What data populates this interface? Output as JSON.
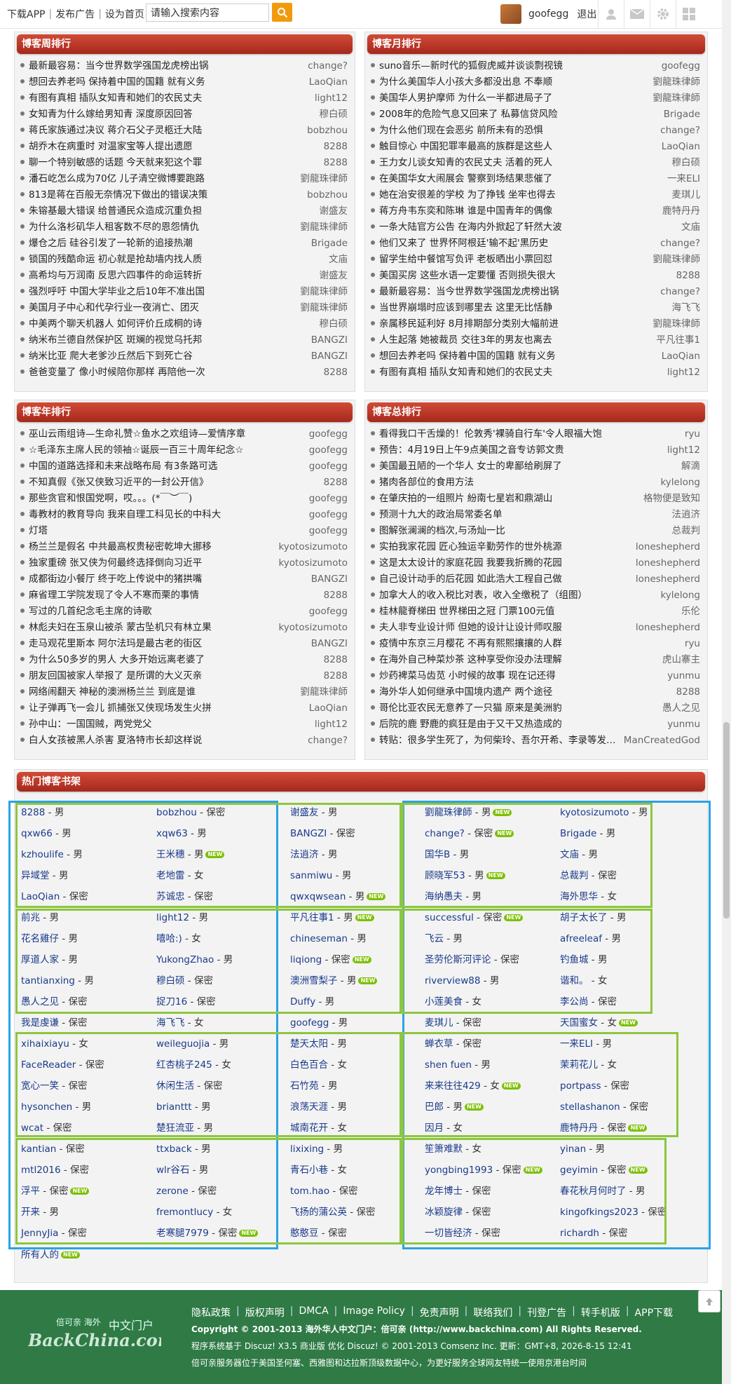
{
  "topbar": {
    "nav": [
      "下载APP",
      "发布广告",
      "设为首页"
    ],
    "search_placeholder": "请输入搜索内容",
    "username": "goofegg",
    "logout": "退出"
  },
  "panels": {
    "weekly": {
      "title": "博客周排行",
      "items": [
        {
          "t": "最新最容易：当今世界数学强国龙虎榜出锅",
          "a": "change?"
        },
        {
          "t": "想回去养老吗 保持着中国的国籍 就有义务",
          "a": "LaoQian"
        },
        {
          "t": "有图有真相 插队女知青和她们的农民丈夫",
          "a": "light12"
        },
        {
          "t": "女知青为什么嫁给男知青 深度原因回答",
          "a": "穆白硕"
        },
        {
          "t": "蒋氏家族通过决议 蒋介石父子灵柩迁大陆",
          "a": "bobzhou"
        },
        {
          "t": "胡乔木在病重时 对温家宝等人提出遗愿",
          "a": "8288"
        },
        {
          "t": "聊一个特别敏感的话题 今天就来犯这个罪",
          "a": "8288"
        },
        {
          "t": "潘石屹怎么成为70亿 儿子清空微博要跑路",
          "a": "劉龍珠律師"
        },
        {
          "t": "813是蒋在百般无奈情况下做出的错误决策",
          "a": "bobzhou"
        },
        {
          "t": "朱镕基最大错误 给普通民众造成沉重负担",
          "a": "谢盛友"
        },
        {
          "t": "为什么洛杉矶华人租客数不尽的恩怨情仇",
          "a": "劉龍珠律師"
        },
        {
          "t": "爆仓之后 硅谷引发了一轮新的追接热潮",
          "a": "Brigade"
        },
        {
          "t": "锁国的残酷命运 初心就是抢劫墙内找人质",
          "a": "文庙"
        },
        {
          "t": "高希均与万润南 反思六四事件的命运转折",
          "a": "谢盛友"
        },
        {
          "t": "强烈呼吁 中国大学毕业之后10年不准出国",
          "a": "劉龍珠律師"
        },
        {
          "t": "美国月子中心和代孕行业一夜消亡、团灭",
          "a": "劉龍珠律師"
        },
        {
          "t": "中美两个聊天机器人 如何评价丘成桐的诗",
          "a": "穆白硕"
        },
        {
          "t": "纳米布兰德自然保护区 斑斓的视觉乌托邦",
          "a": "BANGZI"
        },
        {
          "t": "纳米比亚 爬大老爹沙丘然后下到死亡谷",
          "a": "BANGZI"
        },
        {
          "t": "爸爸变量了 像小时候陪你那样 再陪他一次",
          "a": "8288"
        }
      ]
    },
    "monthly": {
      "title": "博客月排行",
      "items": [
        {
          "t": "suno音乐—新时代的狐假虎威并谈谈剽视镜",
          "a": "goofegg"
        },
        {
          "t": "为什么美国华人小孩大多都没出息 不奉顺",
          "a": "劉龍珠律師"
        },
        {
          "t": "美国华人男护摩师 为什么一半都进局子了",
          "a": "劉龍珠律師"
        },
        {
          "t": "2008年的危险气息又回来了 私募信贷风险",
          "a": "Brigade"
        },
        {
          "t": "为什么他们现在会恶劣 前所未有的恐惧",
          "a": "change?"
        },
        {
          "t": "触目惊心 中国犯罪率最高的族群是这些人",
          "a": "LaoQian"
        },
        {
          "t": "王力女儿谈女知青的农民丈夫 活着的死人",
          "a": "穆白硕"
        },
        {
          "t": "在美国华女大闹展会 警察到场结果悲催了",
          "a": "一来ELI"
        },
        {
          "t": "她在治安很差的学校 为了挣钱 坐牢也得去",
          "a": "麦琪儿"
        },
        {
          "t": "蒋方舟韦东奕和陈琳 谁是中国青年的偶像",
          "a": "鹿特丹丹"
        },
        {
          "t": "一条大陆官方公告 在海内外掀起了轩然大波",
          "a": "文庙"
        },
        {
          "t": "他们又来了 世界怀阿根廷'输不起'黑历史",
          "a": "change?"
        },
        {
          "t": "留学生给中餐馆写负评 老板晒出小票回怼",
          "a": "劉龍珠律師"
        },
        {
          "t": "美国买房 这些水语一定要懂 否则损失很大",
          "a": "8288"
        },
        {
          "t": "最新最容易：当今世界数学强国龙虎榜出锅",
          "a": "change?"
        },
        {
          "t": "当世界崩塌时应该到哪里去 这里无比恬静",
          "a": "海飞飞"
        },
        {
          "t": "亲属移民延利好 8月排期部分类别大幅前进",
          "a": "劉龍珠律師"
        },
        {
          "t": "人生起落 她被裁员 交往3年的男友也离去",
          "a": "平凡往事1"
        },
        {
          "t": "想回去养老吗 保持着中国的国籍 就有义务",
          "a": "LaoQian"
        },
        {
          "t": "有图有真相 插队女知青和她们的农民丈夫",
          "a": "light12"
        }
      ]
    },
    "yearly": {
      "title": "博客年排行",
      "items": [
        {
          "t": "巫山云雨组诗—生命礼赞☆鱼水之欢组诗—爱情序章",
          "a": "goofegg"
        },
        {
          "t": "☆毛泽东主席人民的领袖☆诞辰一百三十周年纪念☆",
          "a": "goofegg"
        },
        {
          "t": "中国的道路选择和未来战略布局 有3条路可选",
          "a": "goofegg"
        },
        {
          "t": "不知真假《张又侠致习近平的一封公开信》",
          "a": "8288"
        },
        {
          "t": "那些贪官和恨国党啊，哎。。。(*￣︶￣)",
          "a": "goofegg"
        },
        {
          "t": "毒教材的教育导向 我来自理工科见长的中科大",
          "a": "goofegg"
        },
        {
          "t": "灯塔",
          "a": "goofegg"
        },
        {
          "t": "杨兰兰是假名 中共最高权贵秘密乾坤大挪移",
          "a": "kyotosizumoto"
        },
        {
          "t": "独家重磅 张又侠为何最终选择倒向习近平",
          "a": "kyotosizumoto"
        },
        {
          "t": "成都街边小餐厅 终于吃上传说中的猪拱嘴",
          "a": "BANGZI"
        },
        {
          "t": "麻省理工学院发现了令人不寒而栗的事情",
          "a": "8288"
        },
        {
          "t": "写过的几首纪念毛主席的诗歌",
          "a": "goofegg"
        },
        {
          "t": "林彪夫妇在玉泉山被杀 蒙古坠机只有林立果",
          "a": "kyotosizumoto"
        },
        {
          "t": "走马观花里斯本 阿尔法玛是最古老的街区",
          "a": "BANGZI"
        },
        {
          "t": "为什么50多岁的男人 大多开始远离老婆了",
          "a": "8288"
        },
        {
          "t": "朋友回国被家人举报了 是所谓的大义灭亲",
          "a": "8288"
        },
        {
          "t": "网络闹翻天 神秘的澳洲杨兰兰 到底是谁",
          "a": "劉龍珠律師"
        },
        {
          "t": "让子弹再飞一会儿 抓捕张又侠现场发生火拼",
          "a": "LaoQian"
        },
        {
          "t": "孙中山：一国国贼，两党党父",
          "a": "light12"
        },
        {
          "t": "白人女孩被黑人杀害 夏洛特市长却这样说",
          "a": "change?"
        }
      ]
    },
    "total": {
      "title": "博客总排行",
      "items": [
        {
          "t": "看得我口干舌燥的！伦敦秀'裸骑自行车'令人眼福大饱",
          "a": "ryu"
        },
        {
          "t": "预告：4月19日上午9点美国之音专访郭文贵",
          "a": "light12"
        },
        {
          "t": "美国最丑陋的一个华人 女士的卑鄙给刷屏了",
          "a": "解滴"
        },
        {
          "t": "猪肉各部位的食用方法",
          "a": "kylelong"
        },
        {
          "t": "在肇庆拍的一组照片 紛南七星岩和鼎湖山",
          "a": "格物便是致知"
        },
        {
          "t": "预测十九大的政治局常委名单",
          "a": "法逍济"
        },
        {
          "t": "图解张澜澜的档次,与汤灿一比",
          "a": "总裁判"
        },
        {
          "t": "实拍我家花园 匠心独运辛勤劳作的世外桃源",
          "a": "loneshepherd"
        },
        {
          "t": "这是太太设计的家庭花园 我要我折腾的花园",
          "a": "loneshepherd"
        },
        {
          "t": "自己设计动手的后花园 如此浩大工程自己做",
          "a": "loneshepherd"
        },
        {
          "t": "加拿大人的收入税比对表，收入全缴税了（组图）",
          "a": "kylelong"
        },
        {
          "t": "桂林龍脊梯田 世界梯田之冠 门票100元值",
          "a": "乐伦"
        },
        {
          "t": "夫人非专业设计师 但她的设计让设计师叹服",
          "a": "loneshepherd"
        },
        {
          "t": "疫情中东京三月樱花 不再有熙熙攘攘的人群",
          "a": "ryu"
        },
        {
          "t": "在海外自己种菜炒茶 这种享受你没办法理解",
          "a": "虎山寨主"
        },
        {
          "t": "炒药裨菜马齿苋 小时候的故事 现在记还得",
          "a": "yunmu"
        },
        {
          "t": "海外华人如何继承中国境内遗产 两个途径",
          "a": "8288"
        },
        {
          "t": "哥伦比亚农民无意养了一只猫 原来是美洲豹",
          "a": "愚人之见"
        },
        {
          "t": "后院的鹿 野鹿的疯狂是由于又干又热造成的",
          "a": "yunmu"
        },
        {
          "t": "转贴：很多学生死了，为何柴玲、吾尔开希、李录等发达人却不",
          "a": "ManCreatedGod"
        }
      ]
    }
  },
  "shelf": {
    "title": "热门博客书架",
    "rows": [
      [
        {
          "n": "8288",
          "s": "男",
          "new": false
        },
        {
          "n": "bobzhou",
          "s": "保密",
          "new": false
        },
        {
          "n": "谢盛友",
          "s": "男",
          "new": false
        },
        {
          "n": "劉龍珠律師",
          "s": "男",
          "new": true
        },
        {
          "n": "kyotosizumoto",
          "s": "男",
          "new": false
        }
      ],
      [
        {
          "n": "qxw66",
          "s": "男",
          "new": false
        },
        {
          "n": "xqw63",
          "s": "男",
          "new": false
        },
        {
          "n": "BANGZI",
          "s": "保密",
          "new": false
        },
        {
          "n": "change?",
          "s": "保密",
          "new": true
        },
        {
          "n": "Brigade",
          "s": "男",
          "new": false
        }
      ],
      [
        {
          "n": "kzhoulife",
          "s": "男",
          "new": false
        },
        {
          "n": "王米穗",
          "s": "男",
          "new": true
        },
        {
          "n": "法逍济",
          "s": "男",
          "new": false
        },
        {
          "n": "国华B",
          "s": "男",
          "new": false
        },
        {
          "n": "文庙",
          "s": "男",
          "new": false
        }
      ],
      [
        {
          "n": "异域堂",
          "s": "男",
          "new": false
        },
        {
          "n": "老地雷",
          "s": "女",
          "new": false
        },
        {
          "n": "sanmiwu",
          "s": "男",
          "new": false
        },
        {
          "n": "顾晓军53",
          "s": "男",
          "new": true
        },
        {
          "n": "总裁判",
          "s": "保密",
          "new": false
        }
      ],
      [
        {
          "n": "LaoQian",
          "s": "保密",
          "new": false
        },
        {
          "n": "苏诚忠",
          "s": "保密",
          "new": false
        },
        {
          "n": "qwxqwsean",
          "s": "男",
          "new": true
        },
        {
          "n": "海纳愚夫",
          "s": "男",
          "new": false
        },
        {
          "n": "海外思华",
          "s": "女",
          "new": false
        }
      ],
      [
        {
          "n": "前兆",
          "s": "男",
          "new": false
        },
        {
          "n": "light12",
          "s": "男",
          "new": false
        },
        {
          "n": "平凡往事1",
          "s": "男",
          "new": true
        },
        {
          "n": "successful",
          "s": "保密",
          "new": true
        },
        {
          "n": "胡子太长了",
          "s": "男",
          "new": false
        }
      ],
      [
        {
          "n": "花名雞仔",
          "s": "男",
          "new": false
        },
        {
          "n": "嘻哈:)",
          "s": "女",
          "new": false
        },
        {
          "n": "chineseman",
          "s": "男",
          "new": false
        },
        {
          "n": "飞云",
          "s": "男",
          "new": false
        },
        {
          "n": "afreeleaf",
          "s": "男",
          "new": false
        }
      ],
      [
        {
          "n": "厚道人家",
          "s": "男",
          "new": false
        },
        {
          "n": "YukongZhao",
          "s": "男",
          "new": false
        },
        {
          "n": "liqiong",
          "s": "保密",
          "new": true
        },
        {
          "n": "圣劳伦斯河评论",
          "s": "保密",
          "new": false
        },
        {
          "n": "钓鱼城",
          "s": "男",
          "new": false
        }
      ],
      [
        {
          "n": "tantianxing",
          "s": "男",
          "new": false
        },
        {
          "n": "穆白硕",
          "s": "保密",
          "new": false
        },
        {
          "n": "澳洲雪梨子",
          "s": "男",
          "new": true
        },
        {
          "n": "riverview88",
          "s": "男",
          "new": false
        },
        {
          "n": "谐和。",
          "s": "女",
          "new": false
        }
      ],
      [
        {
          "n": "愚人之见",
          "s": "保密",
          "new": false
        },
        {
          "n": "捉刀16",
          "s": "保密",
          "new": false
        },
        {
          "n": "Duffy",
          "s": "男",
          "new": false
        },
        {
          "n": "小莲美食",
          "s": "女",
          "new": false
        },
        {
          "n": "李公尚",
          "s": "保密",
          "new": false
        }
      ],
      [
        {
          "n": "我是虔谦",
          "s": "保密",
          "new": false
        },
        {
          "n": "海飞飞",
          "s": "女",
          "new": false
        },
        {
          "n": "goofegg",
          "s": "男",
          "new": false
        },
        {
          "n": "麦琪儿",
          "s": "保密",
          "new": false
        },
        {
          "n": "天国蜜女",
          "s": "女",
          "new": true
        }
      ],
      [
        {
          "n": "xihaixiayu",
          "s": "女",
          "new": false
        },
        {
          "n": "weileguojia",
          "s": "男",
          "new": false
        },
        {
          "n": "楚天太阳",
          "s": "男",
          "new": false
        },
        {
          "n": "蝉衣草",
          "s": "保密",
          "new": false
        },
        {
          "n": "一来ELI",
          "s": "男",
          "new": false
        }
      ],
      [
        {
          "n": "FaceReader",
          "s": "保密",
          "new": false
        },
        {
          "n": "红杏桃子245",
          "s": "女",
          "new": false
        },
        {
          "n": "白色百合",
          "s": "女",
          "new": false
        },
        {
          "n": "shen fuen",
          "s": "男",
          "new": false
        },
        {
          "n": "茉莉花儿",
          "s": "女",
          "new": false
        }
      ],
      [
        {
          "n": "宽心一笑",
          "s": "保密",
          "new": false
        },
        {
          "n": "休闲生活",
          "s": "保密",
          "new": false
        },
        {
          "n": "石竹苑",
          "s": "男",
          "new": false
        },
        {
          "n": "来来往往429",
          "s": "女",
          "new": true
        },
        {
          "n": "portpass",
          "s": "保密",
          "new": false
        }
      ],
      [
        {
          "n": "hysonchen",
          "s": "男",
          "new": false
        },
        {
          "n": "brianttt",
          "s": "男",
          "new": false
        },
        {
          "n": "浪荡天涯",
          "s": "男",
          "new": false
        },
        {
          "n": "巴郎",
          "s": "男",
          "new": true
        },
        {
          "n": "stellashanon",
          "s": "保密",
          "new": false
        }
      ],
      [
        {
          "n": "wcat",
          "s": "保密",
          "new": false
        },
        {
          "n": "楚狂流亚",
          "s": "男",
          "new": false
        },
        {
          "n": "城南花开",
          "s": "女",
          "new": false
        },
        {
          "n": "因月",
          "s": "女",
          "new": false
        },
        {
          "n": "鹿特丹丹",
          "s": "保密",
          "new": true
        }
      ],
      [
        {
          "n": "kantian",
          "s": "保密",
          "new": false
        },
        {
          "n": "ttxback",
          "s": "男",
          "new": false
        },
        {
          "n": "lixixing",
          "s": "男",
          "new": false
        },
        {
          "n": "笙箫难默",
          "s": "女",
          "new": false
        },
        {
          "n": "yinan",
          "s": "男",
          "new": false
        }
      ],
      [
        {
          "n": "mtl2016",
          "s": "保密",
          "new": false
        },
        {
          "n": "wlr谷石",
          "s": "男",
          "new": false
        },
        {
          "n": "青石小巷",
          "s": "女",
          "new": false
        },
        {
          "n": "yongbing1993",
          "s": "保密",
          "new": true
        },
        {
          "n": "geyimin",
          "s": "保密",
          "new": true
        }
      ],
      [
        {
          "n": "浮平",
          "s": "保密",
          "new": true
        },
        {
          "n": "zerone",
          "s": "保密",
          "new": false
        },
        {
          "n": "tom.hao",
          "s": "保密",
          "new": false
        },
        {
          "n": "龙年博士",
          "s": "保密",
          "new": false
        },
        {
          "n": "春花秋月何时了",
          "s": "男",
          "new": false
        }
      ],
      [
        {
          "n": "开来",
          "s": "男",
          "new": false
        },
        {
          "n": "fremontlucy",
          "s": "女",
          "new": false
        },
        {
          "n": "飞扬的蒲公英",
          "s": "保密",
          "new": false
        },
        {
          "n": "冰颖旋律",
          "s": "保密",
          "new": false
        },
        {
          "n": "kingofkings2023",
          "s": "保密",
          "new": false
        }
      ],
      [
        {
          "n": "JennyJia",
          "s": "保密",
          "new": false
        },
        {
          "n": "老寒腿7979",
          "s": "保密",
          "new": true
        },
        {
          "n": "憨憨豆",
          "s": "保密",
          "new": false
        },
        {
          "n": "一切皆经济",
          "s": "保密",
          "new": false
        },
        {
          "n": "richardh",
          "s": "保密",
          "new": false
        }
      ]
    ],
    "all_people": "所有人的",
    "new_badge": "NEW"
  },
  "footer": {
    "links": [
      "隐私政策",
      "版权声明",
      "DMCA",
      "Image Policy",
      "免责声明",
      "联络我们",
      "刊登广告",
      "转手机版",
      "APP下载"
    ],
    "copyright": "Copyright © 2001-2013 海外华人中文门户：倍可亲 (http://www.backchina.com) All Rights Reserved.",
    "powered": "程序系统基于 Discuz! X3.5 商业版 优化 Discuz! © 2001-2013 Comsenz Inc. 更新：GMT+8, 2026-8-15 12:41",
    "servers": "倍可亲服务器位于美国圣何塞、西雅图和达拉斯顶级数据中心，为更好服务全球网友特统一使用京港台时间",
    "logo_top": "倍可亲 海外",
    "logo_mid": "中文门户",
    "logo_brand": "BackChina.com"
  },
  "colors": {
    "panel_head_top": "#d24a37",
    "panel_head_bottom": "#a5291c",
    "footer_bg": "#2f7a45",
    "green_box": "#8dc63f",
    "blue_box": "#29a3e6",
    "search_btn": "#f29a0e"
  }
}
